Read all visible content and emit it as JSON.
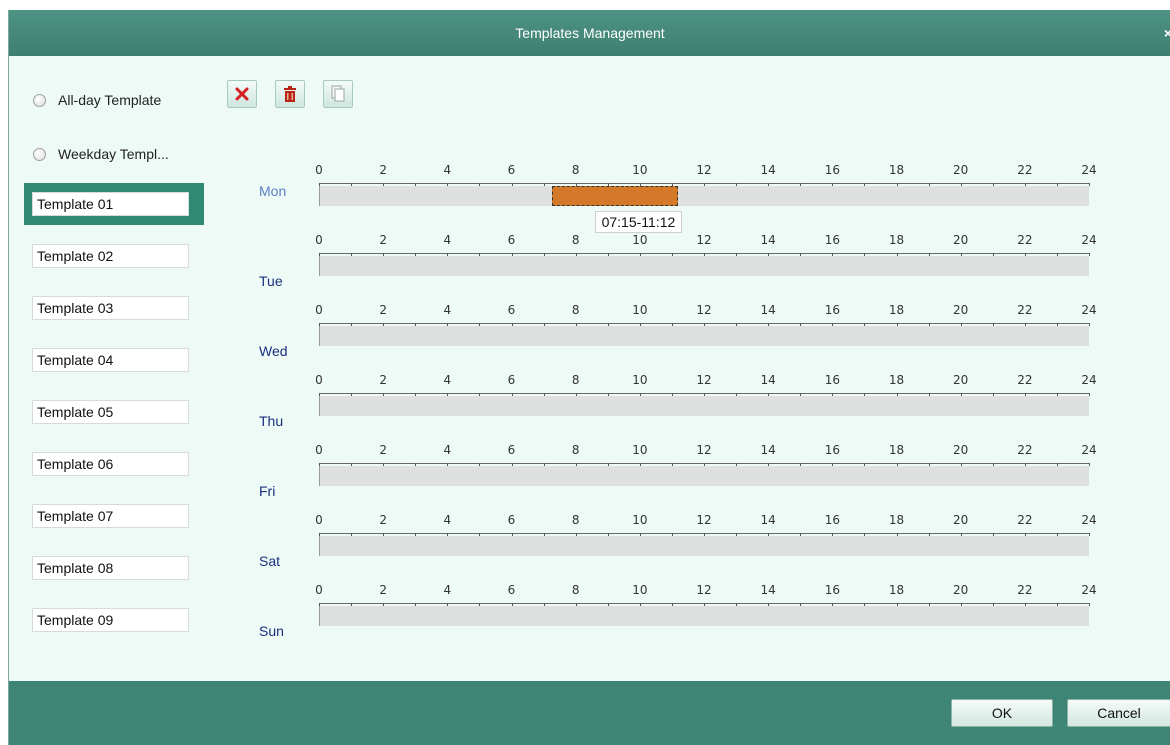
{
  "window": {
    "title": "Templates Management",
    "close_glyph": "×"
  },
  "toolbar": {
    "buttons": [
      {
        "icon": "delete-x-icon",
        "color": "#d42020"
      },
      {
        "icon": "trash-icon",
        "color": "#b82414"
      },
      {
        "icon": "copy-icon",
        "color": "#9aa8a4"
      }
    ]
  },
  "template_types": [
    {
      "label": "All-day Template"
    },
    {
      "label": "Weekday Templ..."
    }
  ],
  "templates": [
    {
      "label": "Template 01",
      "selected": true
    },
    {
      "label": "Template 02",
      "selected": false
    },
    {
      "label": "Template 03",
      "selected": false
    },
    {
      "label": "Template 04",
      "selected": false
    },
    {
      "label": "Template 05",
      "selected": false
    },
    {
      "label": "Template 06",
      "selected": false
    },
    {
      "label": "Template 07",
      "selected": false
    },
    {
      "label": "Template 08",
      "selected": false
    },
    {
      "label": "Template 09",
      "selected": false
    }
  ],
  "schedule": {
    "hour_labels": [
      "0",
      "2",
      "4",
      "6",
      "8",
      "10",
      "12",
      "14",
      "16",
      "18",
      "20",
      "22",
      "24"
    ],
    "days": [
      {
        "label": "Mon",
        "active": true,
        "segments": [
          {
            "start": 7.25,
            "end": 11.2,
            "tooltip": "07:15-11:12"
          }
        ]
      },
      {
        "label": "Tue",
        "active": false,
        "segments": []
      },
      {
        "label": "Wed",
        "active": false,
        "segments": []
      },
      {
        "label": "Thu",
        "active": false,
        "segments": []
      },
      {
        "label": "Fri",
        "active": false,
        "segments": []
      },
      {
        "label": "Sat",
        "active": false,
        "segments": []
      },
      {
        "label": "Sun",
        "active": false,
        "segments": []
      }
    ],
    "segment_color": "#d4782a"
  },
  "footer": {
    "ok_label": "OK",
    "cancel_label": "Cancel"
  },
  "colors": {
    "titlebar": "#458a7a",
    "selected": "#2e8a72",
    "background": "#eefaf6"
  }
}
